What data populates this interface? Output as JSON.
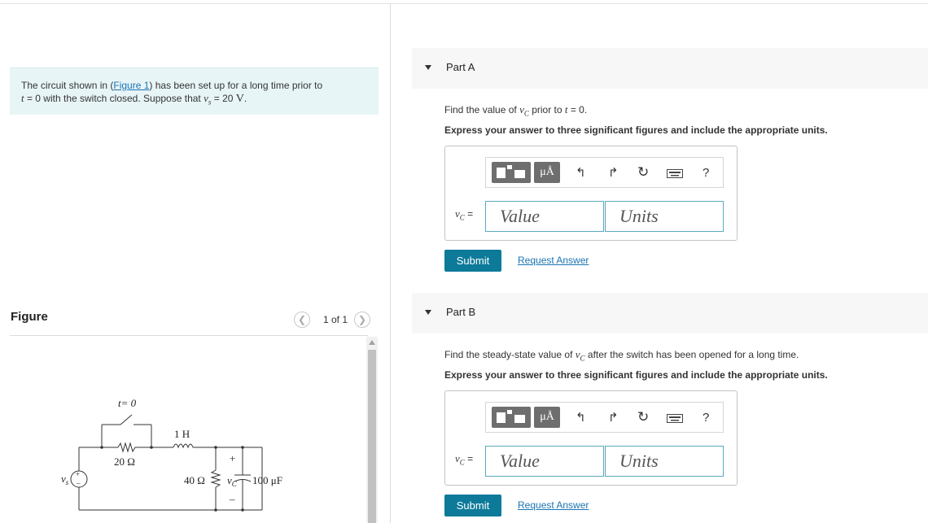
{
  "problem": {
    "pre_link": "The circuit shown in (",
    "link": "Figure 1",
    "post_link": ") has been set up for a long time prior to",
    "t_symbol": "t",
    "line2_mid": " = 0 with the switch closed. Suppose that ",
    "vs_symbol": "v",
    "vs_sub": "s",
    "line2_end": " = 20 ",
    "unit": "V",
    "period": "."
  },
  "figure": {
    "title": "Figure",
    "pager_text": "1 of 1",
    "circuit": {
      "t0": "t= 0",
      "inductor": "1 H",
      "r1": "20 Ω",
      "r2": "40 Ω",
      "plus": "+",
      "minus": "–",
      "vc": "v",
      "vc_sub": "C",
      "cap": "100 μF",
      "src_v": "v",
      "src_sub": "s",
      "src_plus": "+",
      "src_minus": "–"
    }
  },
  "parts": [
    {
      "title": "Part A",
      "q_pre": "Find the value of ",
      "q_var": "v",
      "q_sub": "C",
      "q_post": " prior to ",
      "q_t": "t",
      "q_end": " = 0.",
      "instruction": "Express your answer to three significant figures and include the appropriate units.",
      "eq_label_var": "v",
      "eq_label_sub": "C",
      "eq_label_eq": " =",
      "value_placeholder": "Value",
      "units_placeholder": "Units",
      "submit": "Submit",
      "request": "Request Answer"
    },
    {
      "title": "Part B",
      "q_pre": "Find the steady-state value of ",
      "q_var": "v",
      "q_sub": "C",
      "q_post": " after the switch has been opened for a long time.",
      "q_t": "",
      "q_end": "",
      "instruction": "Express your answer to three significant figures and include the appropriate units.",
      "eq_label_var": "v",
      "eq_label_sub": "C",
      "eq_label_eq": " =",
      "value_placeholder": "Value",
      "units_placeholder": "Units",
      "submit": "Submit",
      "request": "Request Answer"
    }
  ],
  "toolbar": {
    "units_btn": "μÅ",
    "help": "?",
    "icons": [
      "templates-icon",
      "units-icon",
      "undo-icon",
      "redo-icon",
      "reset-icon",
      "keyboard-icon",
      "help-icon"
    ]
  },
  "colors": {
    "accent": "#0d7a9a",
    "link": "#1a74b3",
    "problem_bg": "#e8f5f7",
    "field_border": "#5ba9be"
  }
}
